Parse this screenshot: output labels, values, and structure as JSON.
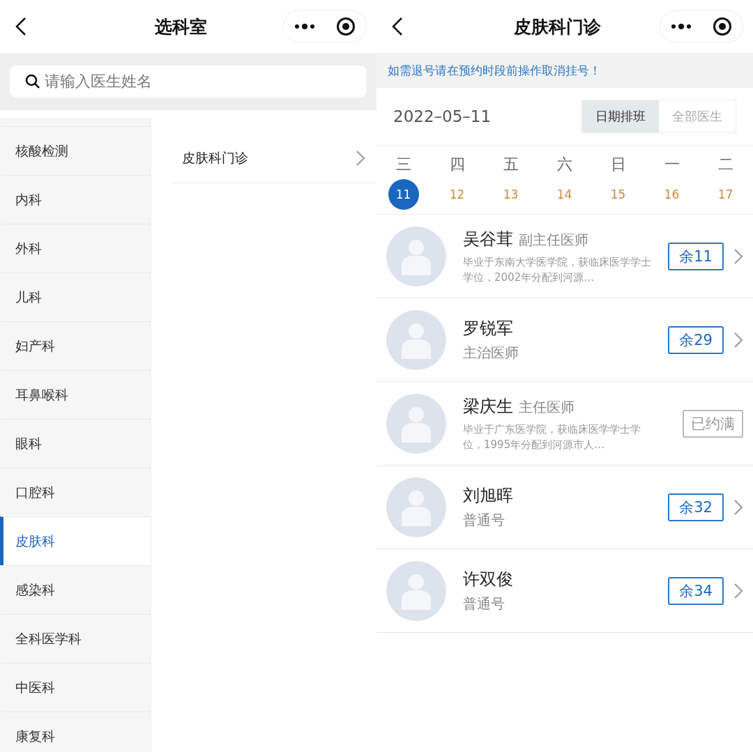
{
  "left": {
    "header": {
      "title": "选科室"
    },
    "search": {
      "placeholder": "请输入医生姓名"
    },
    "departments": [
      {
        "label": "核酸检测",
        "selected": false
      },
      {
        "label": "内科",
        "selected": false
      },
      {
        "label": "外科",
        "selected": false
      },
      {
        "label": "儿科",
        "selected": false
      },
      {
        "label": "妇产科",
        "selected": false
      },
      {
        "label": "耳鼻喉科",
        "selected": false
      },
      {
        "label": "眼科",
        "selected": false
      },
      {
        "label": "口腔科",
        "selected": false
      },
      {
        "label": "皮肤科",
        "selected": true
      },
      {
        "label": "感染科",
        "selected": false
      },
      {
        "label": "全科医学科",
        "selected": false
      },
      {
        "label": "中医科",
        "selected": false
      },
      {
        "label": "康复科",
        "selected": false
      }
    ],
    "clinics": [
      {
        "label": "皮肤科门诊"
      }
    ]
  },
  "right": {
    "header": {
      "title": "皮肤科门诊"
    },
    "notice": "如需退号请在预约时段前操作取消挂号！",
    "date": "2022–05–11",
    "view_tabs": [
      {
        "label": "日期排班",
        "selected": true
      },
      {
        "label": "全部医生",
        "selected": false
      }
    ],
    "days": [
      {
        "weekday": "三",
        "date": "11",
        "selected": true
      },
      {
        "weekday": "四",
        "date": "12",
        "selected": false
      },
      {
        "weekday": "五",
        "date": "13",
        "selected": false
      },
      {
        "weekday": "六",
        "date": "14",
        "selected": false
      },
      {
        "weekday": "日",
        "date": "15",
        "selected": false
      },
      {
        "weekday": "一",
        "date": "16",
        "selected": false
      },
      {
        "weekday": "二",
        "date": "17",
        "selected": false
      }
    ],
    "doctors": [
      {
        "name": "吴谷茸",
        "title": "副主任医师",
        "bio": "毕业于东南大学医学院，获临床医学学士学位，2002年分配到河源…",
        "kind": "available",
        "slots": "余11"
      },
      {
        "name": "罗锐军",
        "title": "主治医师",
        "kind": "available",
        "slots": "余29"
      },
      {
        "name": "梁庆生",
        "title": "主任医师",
        "bio": "毕业于广东医学院，获临床医学学士学位，1995年分配到河源市人…",
        "kind": "full",
        "slots": "已约满"
      },
      {
        "name": "刘旭晖",
        "title": "普通号",
        "kind": "available",
        "slots": "余32"
      },
      {
        "name": "许双俊",
        "title": "普通号",
        "kind": "available",
        "slots": "余34"
      }
    ]
  }
}
